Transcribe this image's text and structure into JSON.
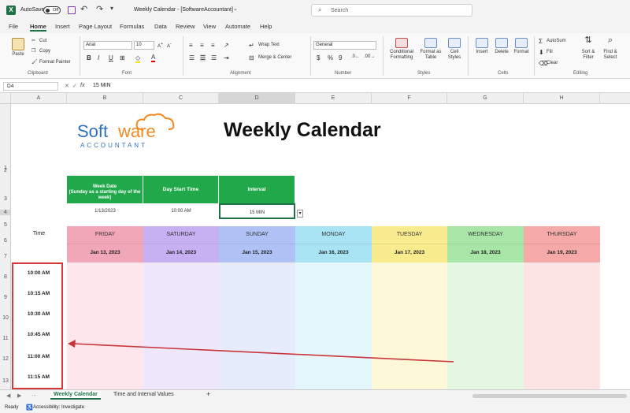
{
  "titlebar": {
    "autosave": "AutoSave",
    "toggle": "Off",
    "doc_title": "Weekly Calendar - [SoftwareAccountant]",
    "search": "Search"
  },
  "menu": [
    "File",
    "Home",
    "Insert",
    "Page Layout",
    "Formulas",
    "Data",
    "Review",
    "View",
    "Automate",
    "Help"
  ],
  "ribbon": {
    "clipboard": {
      "paste": "Paste",
      "cut": "Cut",
      "copy": "Copy",
      "format_painter": "Format Painter",
      "label": "Clipboard"
    },
    "font": {
      "name": "Arial",
      "size": "10",
      "label": "Font"
    },
    "alignment": {
      "wrap": "Wrap Text",
      "merge": "Merge & Center",
      "label": "Alignment"
    },
    "number": {
      "format": "General",
      "label": "Number"
    },
    "styles": {
      "cond": "Conditional Formatting",
      "table": "Format as Table",
      "cell": "Cell Styles",
      "label": "Styles"
    },
    "cells": {
      "insert": "Insert",
      "delete": "Delete",
      "format": "Format",
      "label": "Cells"
    },
    "editing": {
      "autosum": "AutoSum",
      "fill": "Fill",
      "clear": "Clear",
      "sort": "Sort & Filter",
      "find": "Find & Select",
      "label": "Editing"
    }
  },
  "formula_bar": {
    "cell_ref": "D4",
    "fx": "fx",
    "value": "15 MIN"
  },
  "columns": [
    "A",
    "B",
    "C",
    "D",
    "E",
    "F",
    "G",
    "H"
  ],
  "rows": [
    "1",
    "2",
    "3",
    "4",
    "5",
    "6",
    "7",
    "8",
    "9",
    "10",
    "11",
    "12",
    "13"
  ],
  "logo": {
    "part1": "Soft",
    "part2": "ware",
    "sub": "ACCOUNTANT"
  },
  "title": "Weekly Calendar",
  "settings": {
    "headers": [
      "Week Date\n(Sunday as a starting day of the week)",
      "Day Start Time",
      "Interval"
    ],
    "values": [
      "1/13/2023",
      "10:00 AM",
      "15 MIN"
    ]
  },
  "time_label": "Time",
  "days": [
    {
      "name": "FRIDAY",
      "date": "Jan 13, 2023",
      "color": "#f2a7b8",
      "light": "#fde6ec"
    },
    {
      "name": "SATURDAY",
      "date": "Jan 14, 2023",
      "color": "#c7b1f2",
      "light": "#efe8fd"
    },
    {
      "name": "SUNDAY",
      "date": "Jan 15, 2023",
      "color": "#b0c2f5",
      "light": "#e7ecfd"
    },
    {
      "name": "MONDAY",
      "date": "Jan 16, 2023",
      "color": "#a9e4f5",
      "light": "#e4f7fd"
    },
    {
      "name": "TUESDAY",
      "date": "Jan 17, 2023",
      "color": "#f8ec8f",
      "light": "#fdf8d8"
    },
    {
      "name": "WEDNESDAY",
      "date": "Jan 18, 2023",
      "color": "#a8e6a8",
      "light": "#e4f8e4"
    },
    {
      "name": "THURSDAY",
      "date": "Jan 19, 2023",
      "color": "#f5a9a9",
      "light": "#fde4e4"
    }
  ],
  "times": [
    "10:00 AM",
    "10:15 AM",
    "10:30 AM",
    "10:45 AM",
    "11:00 AM",
    "11:15 AM"
  ],
  "sheet_tabs": [
    "Weekly Calendar",
    "Time and Interval Values",
    "+"
  ],
  "status": {
    "ready": "Ready",
    "accessibility": "Accessibility: Investigate"
  },
  "colors": {
    "excel_green": "#21a84a",
    "highlight": "#d9383a",
    "arrow": "#c9353a"
  }
}
